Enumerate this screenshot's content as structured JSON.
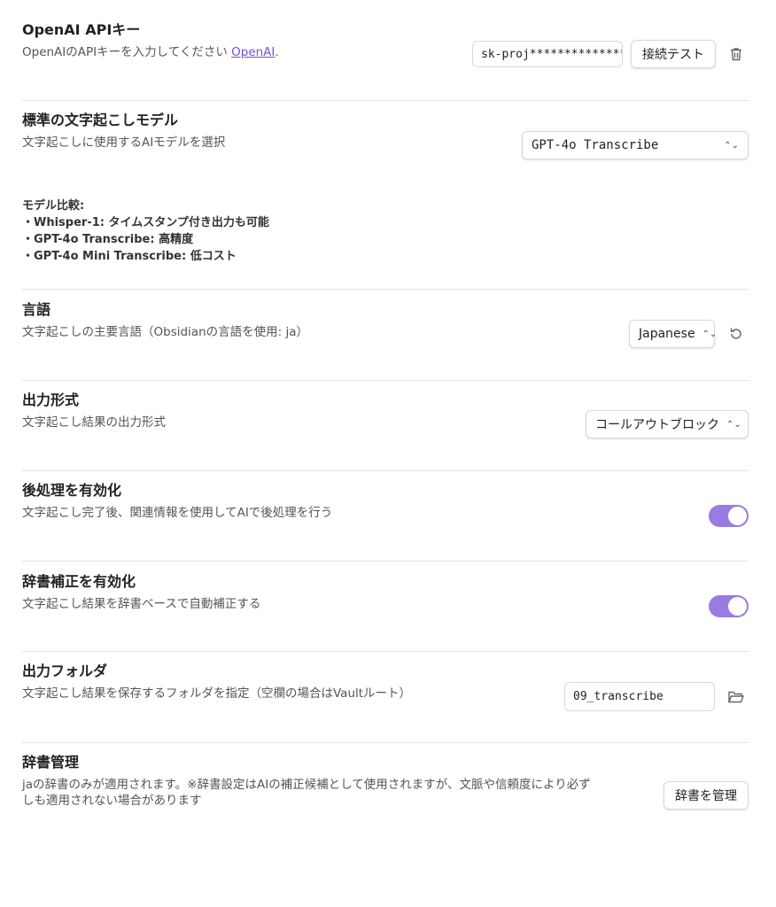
{
  "api_key": {
    "title": "OpenAI APIキー",
    "desc_prefix": "OpenAIのAPIキーを入力してください ",
    "desc_link": "OpenAI",
    "desc_suffix": ".",
    "value": "sk-proj**************",
    "test_button": "接続テスト"
  },
  "model": {
    "title": "標準の文字起こしモデル",
    "desc": "文字起こしに使用するAIモデルを選択",
    "selected": "GPT-4o Transcribe",
    "compare_title": "モデル比較:",
    "compare_lines": [
      "・Whisper-1: タイムスタンプ付き出力も可能",
      "・GPT-4o Transcribe: 高精度",
      "・GPT-4o Mini Transcribe: 低コスト"
    ]
  },
  "language": {
    "title": "言語",
    "desc": "文字起こしの主要言語（Obsidianの言語を使用: ja）",
    "selected": "Japanese"
  },
  "output_format": {
    "title": "出力形式",
    "desc": "文字起こし結果の出力形式",
    "selected": "コールアウトブロック"
  },
  "postprocess": {
    "title": "後処理を有効化",
    "desc": "文字起こし完了後、関連情報を使用してAIで後処理を行う",
    "enabled": true
  },
  "dictionary_correction": {
    "title": "辞書補正を有効化",
    "desc": "文字起こし結果を辞書ベースで自動補正する",
    "enabled": true
  },
  "output_folder": {
    "title": "出力フォルダ",
    "desc": "文字起こし結果を保存するフォルダを指定（空欄の場合はVaultルート）",
    "value": "09_transcribe"
  },
  "dictionary_management": {
    "title": "辞書管理",
    "desc_line1": "jaの辞書のみが適用されます。※辞書設定はAIの補正候補として使用されますが、文脈や信頼度により必ず",
    "desc_line2": "しも適用されない場合があります",
    "button": "辞書を管理"
  },
  "colors": {
    "accent": "#9a7ae3",
    "link": "#7a4fd6"
  },
  "icons": [
    "trash-icon",
    "reset-icon",
    "folder-icon",
    "chevron-updown-icon"
  ]
}
